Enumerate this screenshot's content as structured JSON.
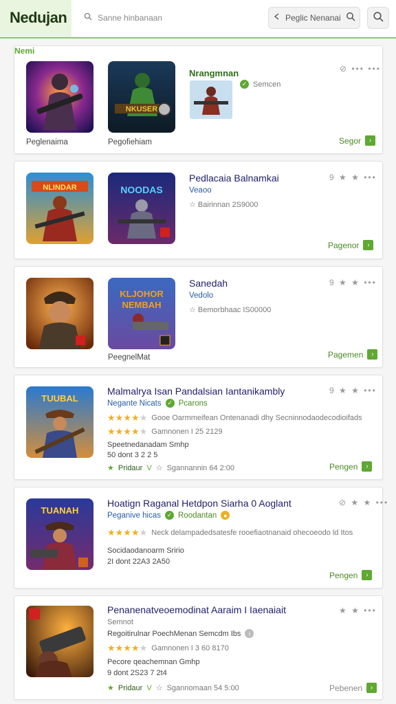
{
  "header": {
    "logo": "Nedujan",
    "search_placeholder": "Sanne hinbanaan",
    "search2_text": "Peglic Nenanai"
  },
  "cards": [
    {
      "thumb1_caption": "Peglenaima",
      "thumb2_caption": "Pegofiehiam",
      "title": "Nrangmnan",
      "title_tag": "Nemi",
      "sub_meta": "Semcen",
      "action": "Segor"
    },
    {
      "title": "Pedlacaia Balnamkai",
      "sub": "Veaoo",
      "meta": "Bairinnan 2S9000",
      "controls": "9 ★ ★ •••",
      "action": "Pagenor"
    },
    {
      "title": "Sanedah",
      "sub": "Vedolo",
      "meta": "Bemorbhaac IS00000",
      "thumb2_caption": "PeegnelMat",
      "controls": "9 ★ ★ •••",
      "action": "Pagemen"
    },
    {
      "title": "Malmalrya Isan Pandalsian Iantanikambly",
      "sub": "Negante Nicats",
      "sub_tag": "Pcarons",
      "rating1": 4,
      "line1": "Gooe Oarmmeifean Ontenanadi dhy Secninnodaodecodioifads",
      "rating2": 4,
      "line2": "Gamnonen I 25 2129",
      "line3": "Speetnedanadam Smhp",
      "line4": "50 dont 3 2 2 5",
      "footer_left": "Pridaur",
      "footer_meta": "Sgannannin 64 2:00",
      "controls": "9 ★ ★ •••",
      "action": "Pengen"
    },
    {
      "title": "Hoatign Raganal Hetdpon Siarha 0 Aoglant",
      "sub": "Peganive hicas",
      "sub_tag": "Roodantan",
      "rating1": 4,
      "line1": "Neck delampadedsatesfe rooefiaotnanaid ohecoeodo ld Itos",
      "line3": "Socidaodanoarm Sririo",
      "line4": "2I dont 22A3 2A50",
      "controls": "⊘ ★ ★ •••",
      "action": "Pengen"
    },
    {
      "title": "Penanenatveoemodinat Aaraim I Iaenaiait",
      "sub": "Semnot",
      "sub_meta": "Regoitirulnar PoechMenan Semcdm Ibs",
      "rating1": 4,
      "line1": "Gamnonen I 3 60 8170",
      "line3": "Pecore qeachemnan Gmhp",
      "line4": "9 dont 2S23 7 2t4",
      "footer_left": "Pridaur",
      "footer_meta": "Sgannomaan 54 5:00",
      "controls": "★ ★ •••",
      "action": "Pebenen"
    }
  ],
  "colors": {
    "accent_green": "#5fa832",
    "title_blue": "#1f1f6a",
    "link_blue": "#2a5ca8",
    "star": "#f0b020"
  }
}
